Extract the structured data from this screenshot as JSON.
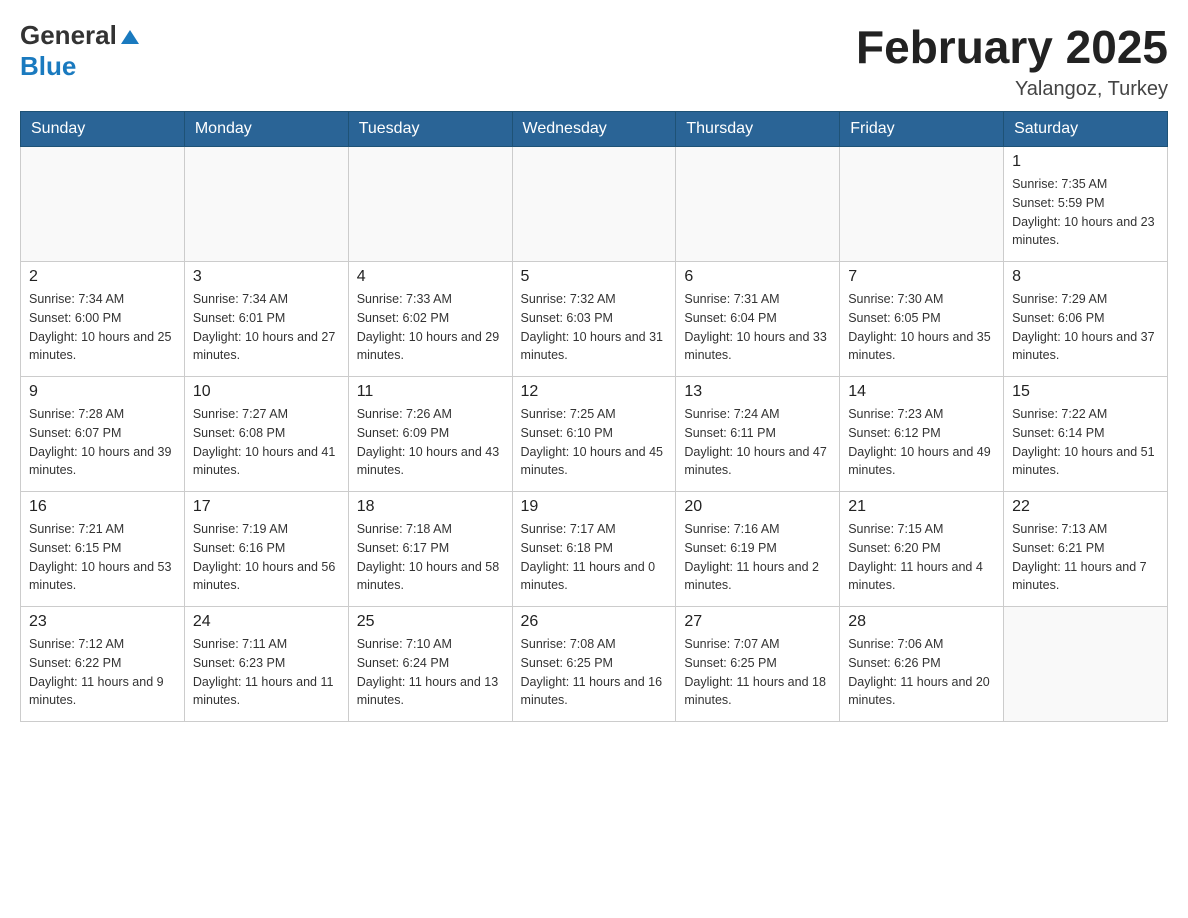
{
  "header": {
    "logo_general": "General",
    "logo_blue": "Blue",
    "month_title": "February 2025",
    "location": "Yalangoz, Turkey"
  },
  "weekdays": [
    "Sunday",
    "Monday",
    "Tuesday",
    "Wednesday",
    "Thursday",
    "Friday",
    "Saturday"
  ],
  "weeks": [
    [
      {
        "day": "",
        "info": ""
      },
      {
        "day": "",
        "info": ""
      },
      {
        "day": "",
        "info": ""
      },
      {
        "day": "",
        "info": ""
      },
      {
        "day": "",
        "info": ""
      },
      {
        "day": "",
        "info": ""
      },
      {
        "day": "1",
        "info": "Sunrise: 7:35 AM\nSunset: 5:59 PM\nDaylight: 10 hours and 23 minutes."
      }
    ],
    [
      {
        "day": "2",
        "info": "Sunrise: 7:34 AM\nSunset: 6:00 PM\nDaylight: 10 hours and 25 minutes."
      },
      {
        "day": "3",
        "info": "Sunrise: 7:34 AM\nSunset: 6:01 PM\nDaylight: 10 hours and 27 minutes."
      },
      {
        "day": "4",
        "info": "Sunrise: 7:33 AM\nSunset: 6:02 PM\nDaylight: 10 hours and 29 minutes."
      },
      {
        "day": "5",
        "info": "Sunrise: 7:32 AM\nSunset: 6:03 PM\nDaylight: 10 hours and 31 minutes."
      },
      {
        "day": "6",
        "info": "Sunrise: 7:31 AM\nSunset: 6:04 PM\nDaylight: 10 hours and 33 minutes."
      },
      {
        "day": "7",
        "info": "Sunrise: 7:30 AM\nSunset: 6:05 PM\nDaylight: 10 hours and 35 minutes."
      },
      {
        "day": "8",
        "info": "Sunrise: 7:29 AM\nSunset: 6:06 PM\nDaylight: 10 hours and 37 minutes."
      }
    ],
    [
      {
        "day": "9",
        "info": "Sunrise: 7:28 AM\nSunset: 6:07 PM\nDaylight: 10 hours and 39 minutes."
      },
      {
        "day": "10",
        "info": "Sunrise: 7:27 AM\nSunset: 6:08 PM\nDaylight: 10 hours and 41 minutes."
      },
      {
        "day": "11",
        "info": "Sunrise: 7:26 AM\nSunset: 6:09 PM\nDaylight: 10 hours and 43 minutes."
      },
      {
        "day": "12",
        "info": "Sunrise: 7:25 AM\nSunset: 6:10 PM\nDaylight: 10 hours and 45 minutes."
      },
      {
        "day": "13",
        "info": "Sunrise: 7:24 AM\nSunset: 6:11 PM\nDaylight: 10 hours and 47 minutes."
      },
      {
        "day": "14",
        "info": "Sunrise: 7:23 AM\nSunset: 6:12 PM\nDaylight: 10 hours and 49 minutes."
      },
      {
        "day": "15",
        "info": "Sunrise: 7:22 AM\nSunset: 6:14 PM\nDaylight: 10 hours and 51 minutes."
      }
    ],
    [
      {
        "day": "16",
        "info": "Sunrise: 7:21 AM\nSunset: 6:15 PM\nDaylight: 10 hours and 53 minutes."
      },
      {
        "day": "17",
        "info": "Sunrise: 7:19 AM\nSunset: 6:16 PM\nDaylight: 10 hours and 56 minutes."
      },
      {
        "day": "18",
        "info": "Sunrise: 7:18 AM\nSunset: 6:17 PM\nDaylight: 10 hours and 58 minutes."
      },
      {
        "day": "19",
        "info": "Sunrise: 7:17 AM\nSunset: 6:18 PM\nDaylight: 11 hours and 0 minutes."
      },
      {
        "day": "20",
        "info": "Sunrise: 7:16 AM\nSunset: 6:19 PM\nDaylight: 11 hours and 2 minutes."
      },
      {
        "day": "21",
        "info": "Sunrise: 7:15 AM\nSunset: 6:20 PM\nDaylight: 11 hours and 4 minutes."
      },
      {
        "day": "22",
        "info": "Sunrise: 7:13 AM\nSunset: 6:21 PM\nDaylight: 11 hours and 7 minutes."
      }
    ],
    [
      {
        "day": "23",
        "info": "Sunrise: 7:12 AM\nSunset: 6:22 PM\nDaylight: 11 hours and 9 minutes."
      },
      {
        "day": "24",
        "info": "Sunrise: 7:11 AM\nSunset: 6:23 PM\nDaylight: 11 hours and 11 minutes."
      },
      {
        "day": "25",
        "info": "Sunrise: 7:10 AM\nSunset: 6:24 PM\nDaylight: 11 hours and 13 minutes."
      },
      {
        "day": "26",
        "info": "Sunrise: 7:08 AM\nSunset: 6:25 PM\nDaylight: 11 hours and 16 minutes."
      },
      {
        "day": "27",
        "info": "Sunrise: 7:07 AM\nSunset: 6:25 PM\nDaylight: 11 hours and 18 minutes."
      },
      {
        "day": "28",
        "info": "Sunrise: 7:06 AM\nSunset: 6:26 PM\nDaylight: 11 hours and 20 minutes."
      },
      {
        "day": "",
        "info": ""
      }
    ]
  ]
}
